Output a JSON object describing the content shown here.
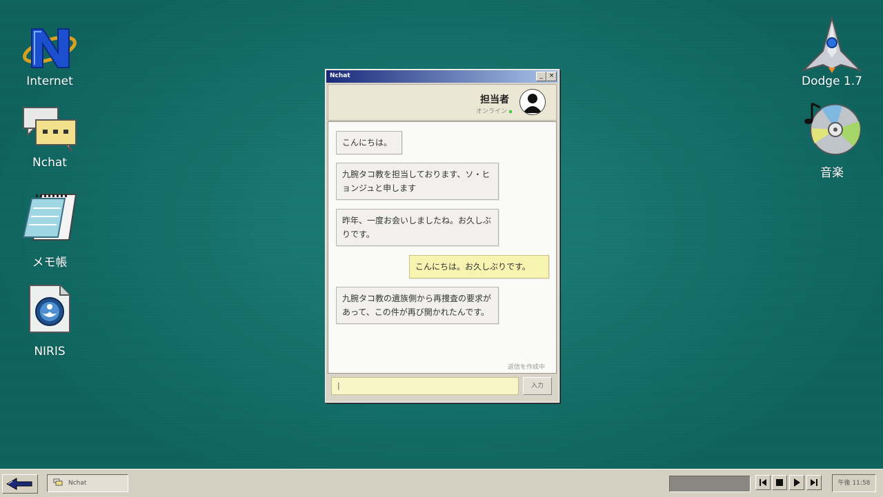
{
  "desktop": {
    "left_icons": [
      {
        "label": "Internet",
        "icon": "internet-n-icon"
      },
      {
        "label": "Nchat",
        "icon": "chat-bubbles-icon"
      },
      {
        "label": "メモ帳",
        "icon": "notepad-icon"
      },
      {
        "label": "NIRIS",
        "icon": "niris-document-icon"
      }
    ],
    "right_icons": [
      {
        "label": "Dodge 1.7",
        "icon": "spaceship-icon"
      },
      {
        "label": "音楽",
        "icon": "music-cd-icon"
      }
    ]
  },
  "window": {
    "title": "Nchat",
    "minimize_glyph": "_",
    "close_glyph": "×",
    "contact": {
      "name": "担当者",
      "status": "オンライン",
      "status_color": "#44cc44"
    },
    "messages": [
      {
        "from": "them",
        "text": "こんにちは。"
      },
      {
        "from": "them",
        "text": "九腕タコ教を担当しております、ソ・ヒョンジュと申します"
      },
      {
        "from": "them",
        "text": "昨年、一度お会いしましたね。お久しぶりです。"
      },
      {
        "from": "me",
        "text": "こんにちは。お久しぶりです。"
      },
      {
        "from": "them",
        "text": "九腕タコ教の遺族側から再捜査の要求があって、この件が再び開かれたんです。"
      }
    ],
    "typing_indicator": "返信を作成中",
    "input_value": "|",
    "send_label": "入力"
  },
  "taskbar": {
    "task_label": "Nchat",
    "clock": "午後 11:58"
  },
  "colors": {
    "desktop": "#137a74",
    "titlebar": "#1a2a7a",
    "my_bubble": "#f7f3b0"
  }
}
